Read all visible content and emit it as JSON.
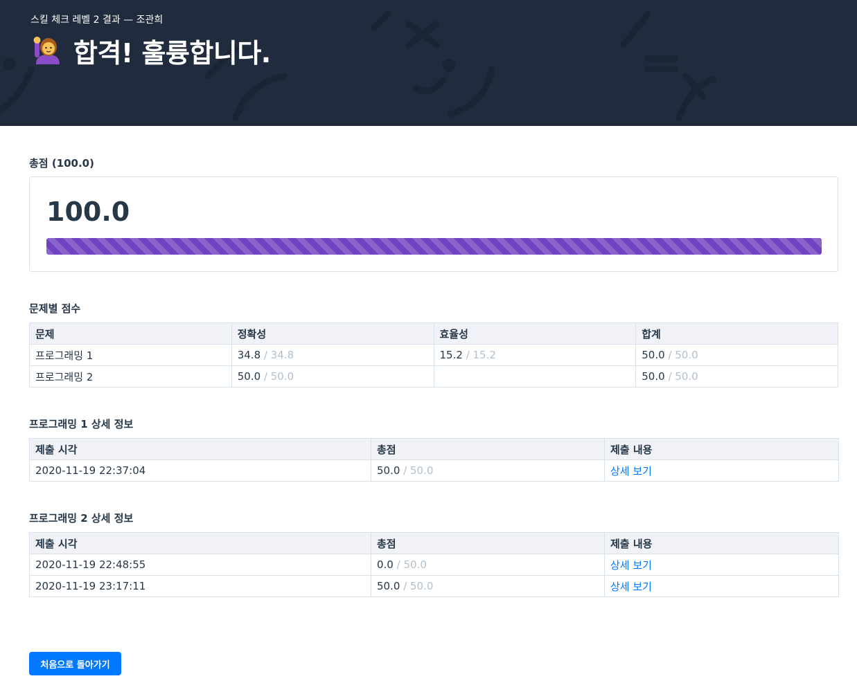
{
  "header": {
    "subtitle": "스킬 체크 레벨 2 결과 — 조관희",
    "title": "합격! 훌륭합니다.",
    "emoji_icon": "person-raising-hand-icon"
  },
  "total": {
    "title": "총점 (100.0)",
    "score": "100.0",
    "progress_percent": 100,
    "bar_color": "#6f42c1"
  },
  "problem_scores": {
    "title": "문제별 점수",
    "headers": [
      "문제",
      "정확성",
      "효율성",
      "합계"
    ],
    "rows": [
      {
        "problem": "프로그래밍 1",
        "accuracy": "34.8",
        "accuracy_max": "/ 34.8",
        "efficiency": "15.2",
        "efficiency_max": "/ 15.2",
        "sum": "50.0",
        "sum_max": "/ 50.0"
      },
      {
        "problem": "프로그래밍 2",
        "accuracy": "50.0",
        "accuracy_max": "/ 50.0",
        "efficiency": "",
        "efficiency_max": "",
        "sum": "50.0",
        "sum_max": "/ 50.0"
      }
    ]
  },
  "detail1": {
    "title": "프로그래밍 1 상세 정보",
    "headers": [
      "제출 시각",
      "총점",
      "제출 내용"
    ],
    "rows": [
      {
        "time": "2020-11-19 22:37:04",
        "score": "50.0",
        "max": "/ 50.0",
        "link": "상세 보기"
      }
    ]
  },
  "detail2": {
    "title": "프로그래밍 2 상세 정보",
    "headers": [
      "제출 시각",
      "총점",
      "제출 내용"
    ],
    "rows": [
      {
        "time": "2020-11-19 22:48:55",
        "score": "0.0",
        "max": "/ 50.0",
        "link": "상세 보기"
      },
      {
        "time": "2020-11-19 23:17:11",
        "score": "50.0",
        "max": "/ 50.0",
        "link": "상세 보기"
      }
    ]
  },
  "back_button": {
    "label": "처음으로 돌아가기"
  },
  "colors": {
    "header_bg": "#202b3d",
    "accent": "#0078ff",
    "muted_max": "#b2c0cc"
  }
}
